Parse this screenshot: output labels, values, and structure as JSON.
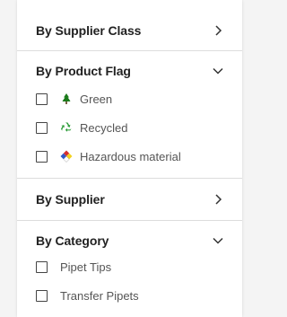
{
  "filters": {
    "supplier_class": {
      "title": "By Supplier Class",
      "state": "collapsed"
    },
    "product_flag": {
      "title": "By Product Flag",
      "state": "expanded",
      "options": [
        {
          "label": "Green",
          "icon": "tree-icon",
          "color": "#1a7a1a"
        },
        {
          "label": "Recycled",
          "icon": "recycle-icon",
          "color": "#2e9d3a"
        },
        {
          "label": "Hazardous material",
          "icon": "hazard-diamond-icon",
          "color": "#d62f2f"
        }
      ]
    },
    "supplier": {
      "title": "By Supplier",
      "state": "collapsed"
    },
    "category": {
      "title": "By Category",
      "state": "expanded",
      "options": [
        {
          "label": "Pipet Tips"
        },
        {
          "label": "Transfer Pipets"
        }
      ]
    }
  }
}
